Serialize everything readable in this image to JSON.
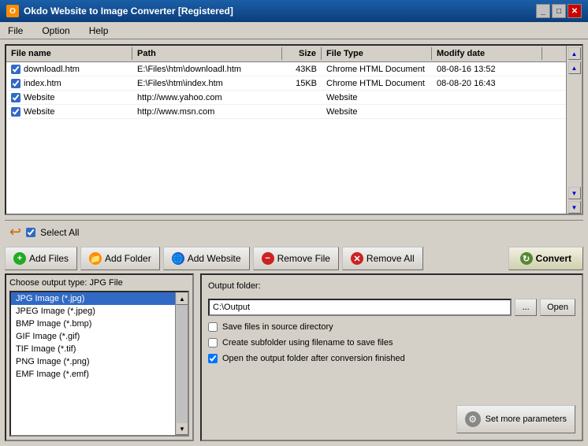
{
  "window": {
    "title": "Okdo Website to Image Converter [Registered]",
    "icon": "O"
  },
  "titleControls": {
    "minimize": "_",
    "restore": "□",
    "close": "✕"
  },
  "menu": {
    "items": [
      "File",
      "Option",
      "Help"
    ]
  },
  "table": {
    "headers": [
      "File name",
      "Path",
      "Size",
      "File Type",
      "Modify date"
    ],
    "rows": [
      {
        "checked": true,
        "name": "downloadl.htm",
        "path": "E:\\Files\\htm\\downloadl.htm",
        "size": "43KB",
        "type": "Chrome HTML Document",
        "date": "08-08-16 13:52"
      },
      {
        "checked": true,
        "name": "index.htm",
        "path": "E:\\Files\\htm\\index.htm",
        "size": "15KB",
        "type": "Chrome HTML Document",
        "date": "08-08-20 16:43"
      },
      {
        "checked": true,
        "name": "Website",
        "path": "http://www.yahoo.com",
        "size": "",
        "type": "Website",
        "date": ""
      },
      {
        "checked": true,
        "name": "Website",
        "path": "http://www.msn.com",
        "size": "",
        "type": "Website",
        "date": ""
      }
    ]
  },
  "selectAll": {
    "label": "Select All",
    "checked": true
  },
  "toolbar": {
    "addFiles": "Add Files",
    "addFolder": "Add Folder",
    "addWebsite": "Add Website",
    "removeFile": "Remove File",
    "removeAll": "Remove All",
    "convert": "Convert"
  },
  "outputType": {
    "label": "Choose output type:",
    "selected": "JPG File",
    "items": [
      "JPG Image (*.jpg)",
      "JPEG Image (*.jpeg)",
      "BMP Image (*.bmp)",
      "GIF Image (*.gif)",
      "TIF Image (*.tif)",
      "PNG Image (*.png)",
      "EMF Image (*.emf)"
    ]
  },
  "outputFolder": {
    "label": "Output folder:",
    "path": "C:\\Output",
    "browseLabel": "...",
    "openLabel": "Open",
    "options": [
      {
        "checked": false,
        "label": "Save files in source directory"
      },
      {
        "checked": false,
        "label": "Create subfolder using filename to save files"
      },
      {
        "checked": true,
        "label": "Open the output folder after conversion finished"
      }
    ],
    "setParamsLabel": "Set more parameters"
  }
}
